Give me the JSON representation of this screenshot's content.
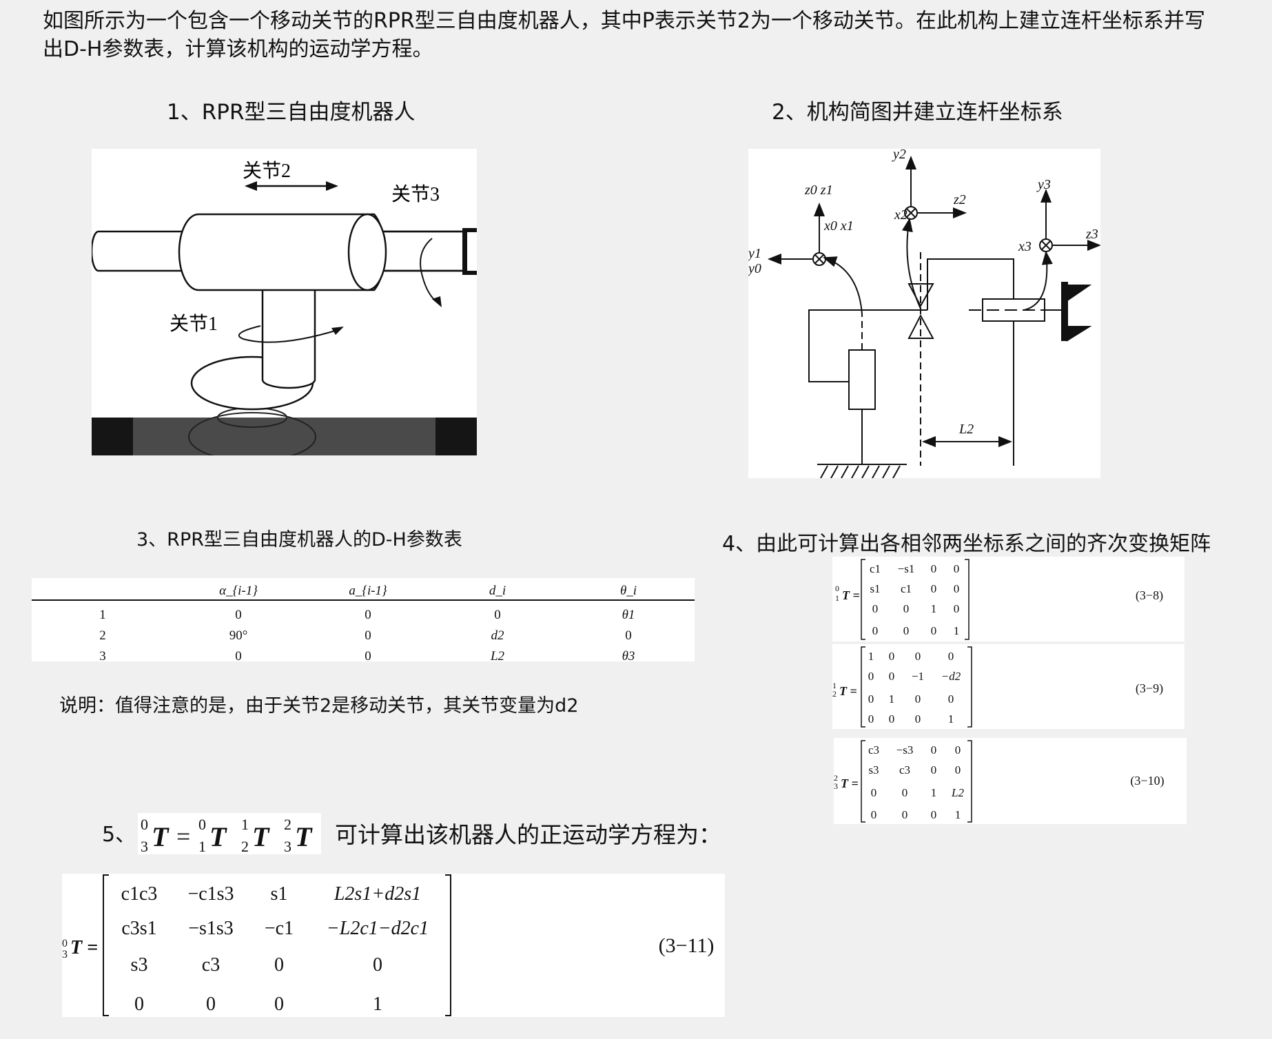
{
  "intro": "如图所示为一个包含一个移动关节的RPR型三自由度机器人，其中P表示关节2为一个移动关节。在此机构上建立连杆坐标系并写出D-H参数表，计算该机构的运动学方程。",
  "sections": {
    "s1": "1、RPR型三自由度机器人",
    "s2": "2、机构简图并建立连杆坐标系",
    "s3": "3、RPR型三自由度机器人的D-H参数表",
    "s4": "4、由此可计算出各相邻两坐标系之间的齐次变换矩阵",
    "s5_prefix": "5、",
    "s5_suffix": "可计算出该机器人的正运动学方程为："
  },
  "figure1": {
    "joint1": "关节1",
    "joint2": "关节2",
    "joint3": "关节3"
  },
  "figure2": {
    "labels": {
      "y0": "y0",
      "y1": "y1",
      "z0z1": "z0 z1",
      "x0x1": "x0 x1",
      "x2": "x2",
      "y2": "y2",
      "z2": "z2",
      "x3": "x3",
      "y3": "y3",
      "z3": "z3",
      "L2": "L2"
    }
  },
  "dh_table": {
    "headers": [
      "",
      "α_{i-1}",
      "a_{i-1}",
      "d_i",
      "θ_i"
    ],
    "rows": [
      [
        "1",
        "0",
        "0",
        "0",
        "θ1"
      ],
      [
        "2",
        "90°",
        "0",
        "d2",
        "0"
      ],
      [
        "3",
        "0",
        "0",
        "L2",
        "θ3"
      ]
    ]
  },
  "note": "说明：值得注意的是，由于关节2是移动关节，其关节变量为d2",
  "matrices": {
    "m1": {
      "label": "T =",
      "sup": "0",
      "sub": "1",
      "eq": "(3−8)",
      "rows": [
        [
          "c1",
          "−s1",
          "0",
          "0"
        ],
        [
          "s1",
          "c1",
          "0",
          "0"
        ],
        [
          "0",
          "0",
          "1",
          "0"
        ],
        [
          "0",
          "0",
          "0",
          "1"
        ]
      ]
    },
    "m2": {
      "label": "T =",
      "sup": "1",
      "sub": "2",
      "eq": "(3−9)",
      "rows": [
        [
          "1",
          "0",
          "0",
          "0"
        ],
        [
          "0",
          "0",
          "−1",
          "−d2"
        ],
        [
          "0",
          "1",
          "0",
          "0"
        ],
        [
          "0",
          "0",
          "0",
          "1"
        ]
      ]
    },
    "m3": {
      "label": "T =",
      "sup": "2",
      "sub": "3",
      "eq": "(3−10)",
      "rows": [
        [
          "c3",
          "−s3",
          "0",
          "0"
        ],
        [
          "s3",
          "c3",
          "0",
          "0"
        ],
        [
          "0",
          "0",
          "1",
          "L2"
        ],
        [
          "0",
          "0",
          "0",
          "1"
        ]
      ]
    },
    "final": {
      "label": "T =",
      "sup": "0",
      "sub": "3",
      "eq": "(3−11)",
      "rows": [
        [
          "c1c3",
          "−c1s3",
          "s1",
          "L2s1+d2s1"
        ],
        [
          "c3s1",
          "−s1s3",
          "−c1",
          "−L2c1−d2c1"
        ],
        [
          "s3",
          "c3",
          "0",
          "0"
        ],
        [
          "0",
          "0",
          "0",
          "1"
        ]
      ]
    }
  },
  "product_formula": {
    "lhs_sup": "0",
    "lhs_sub": "3",
    "f1_sup": "0",
    "f1_sub": "1",
    "f2_sup": "1",
    "f2_sub": "2",
    "f3_sup": "2",
    "f3_sub": "3",
    "T": "T",
    "eq": "="
  }
}
